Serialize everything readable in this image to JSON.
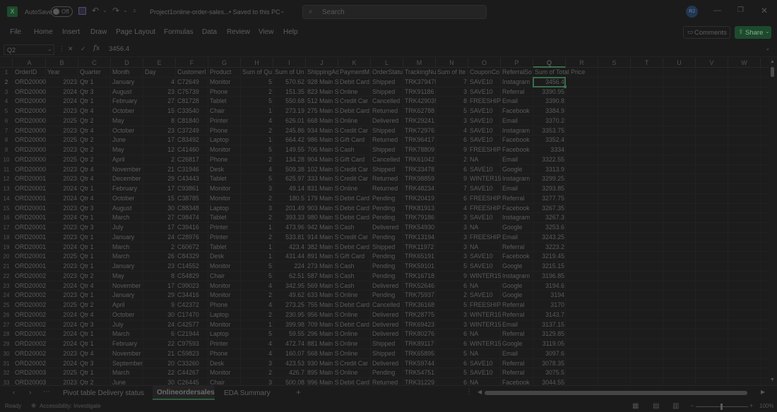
{
  "titlebar": {
    "autosave_label": "AutoSave",
    "autosave_state": "Off",
    "doc_title": "Project1online-order-sales...",
    "saved_status": "• Saved to this PC",
    "search_placeholder": "Search",
    "user_initials": "RJ"
  },
  "ribbon": {
    "tabs": [
      "File",
      "Home",
      "Insert",
      "Draw",
      "Page Layout",
      "Formulas",
      "Data",
      "Review",
      "View",
      "Help"
    ],
    "comments_label": "Comments",
    "share_label": "Share"
  },
  "formula_bar": {
    "name_box": "Q2",
    "fx": "fx",
    "value": "3456.4"
  },
  "columns": [
    "A",
    "B",
    "C",
    "D",
    "E",
    "F",
    "G",
    "H",
    "I",
    "J",
    "K",
    "L",
    "M",
    "N",
    "O",
    "P",
    "Q",
    "R",
    "S",
    "T",
    "U",
    "V",
    "W"
  ],
  "header_row": [
    "OrderID",
    "Year",
    "Quarter",
    "Month",
    "Day",
    "CustomerI",
    "Product",
    "Sum of Qu",
    "Sum of Un",
    "ShippingAd",
    "PaymentM",
    "OrderStatu",
    "TrackingNu",
    "Sum of Ite",
    "CouponCo",
    "ReferralSo",
    "Sum of Total Price"
  ],
  "rows": [
    [
      "ORD20000",
      "2023",
      "Qtr 1",
      "January",
      "4",
      "C72649",
      "Monitor",
      "5",
      "570.62",
      "928 Main S",
      "Debit Card",
      "Shipped",
      "TRK37947!",
      "7",
      "SAVE10",
      "Instagram",
      "3456.4"
    ],
    [
      "ORD20000",
      "2024",
      "Qtr 3",
      "August",
      "23",
      "C75739",
      "Phone",
      "2",
      "151.35",
      "823 Main S",
      "Online",
      "Shipped",
      "TRK91186",
      "3",
      "SAVE10",
      "Referral",
      "3390.95"
    ],
    [
      "ORD20000",
      "2024",
      "Qtr 1",
      "February",
      "27",
      "C81728",
      "Tablet",
      "5",
      "550.68",
      "512 Main S",
      "Credit Car",
      "Cancelled",
      "TRK42903!",
      "8",
      "FREESHIP",
      "Email",
      "3390.8"
    ],
    [
      "ORD20000",
      "2023",
      "Qtr 4",
      "October",
      "15",
      "C33540",
      "Chair",
      "1",
      "273.19",
      "275 Main S",
      "Debit Card",
      "Returned",
      "TRK62788",
      "5",
      "SAVE10",
      "Facebook",
      "3384.9"
    ],
    [
      "ORD20000",
      "2025",
      "Qtr 2",
      "May",
      "8",
      "C81840",
      "Printer",
      "4",
      "626.01",
      "668 Main S",
      "Online",
      "Delivered",
      "TRK29241",
      "3",
      "SAVE10",
      "Email",
      "3370.2"
    ],
    [
      "ORD20000",
      "2023",
      "Qtr 4",
      "October",
      "23",
      "C37249",
      "Phone",
      "2",
      "245.86",
      "934 Main S",
      "Credit Car",
      "Shipped",
      "TRK72976",
      "4",
      "SAVE10",
      "Instagram",
      "3353.75"
    ],
    [
      "ORD20000",
      "2025",
      "Qtr 2",
      "June",
      "17",
      "C83492",
      "Laptop",
      "1",
      "664.42",
      "986 Main S",
      "Gift Card",
      "Returned",
      "TRK96417",
      "6",
      "SAVE10",
      "Facebook",
      "3352.4"
    ],
    [
      "ORD20000",
      "2023",
      "Qtr 2",
      "May",
      "12",
      "C41460",
      "Monitor",
      "5",
      "149.55",
      "706 Main S",
      "Cash",
      "Shipped",
      "TRK78809",
      "9",
      "FREESHIP",
      "Facebook",
      "3334"
    ],
    [
      "ORD20000",
      "2025",
      "Qtr 2",
      "April",
      "2",
      "C26817",
      "Phone",
      "2",
      "134.28",
      "904 Main S",
      "Gift Card",
      "Cancelled",
      "TRK61042",
      "2",
      "NA",
      "Email",
      "3322.55"
    ],
    [
      "ORD20000",
      "2023",
      "Qtr 4",
      "November",
      "21",
      "C31946",
      "Desk",
      "4",
      "509.38",
      "102 Main S",
      "Credit Car",
      "Shipped",
      "TRK33478",
      "6",
      "SAVE10",
      "Google",
      "3313.9"
    ],
    [
      "ORD20001",
      "2023",
      "Qtr 4",
      "December",
      "29",
      "C43443",
      "Tablet",
      "5",
      "625.97",
      "333 Main S",
      "Credit Car",
      "Returned",
      "TRK98859",
      "9",
      "WINTER15",
      "Instagram",
      "3299.25"
    ],
    [
      "ORD20001",
      "2024",
      "Qtr 1",
      "February",
      "17",
      "C93861",
      "Monitor",
      "3",
      "49.14",
      "831 Main S",
      "Online",
      "Returned",
      "TRK48234",
      "7",
      "SAVE10",
      "Email",
      "3293.85"
    ],
    [
      "ORD20001",
      "2024",
      "Qtr 4",
      "October",
      "15",
      "C38785",
      "Monitor",
      "2",
      "180.5",
      "179 Main S",
      "Debit Card",
      "Pending",
      "TRK20419",
      "6",
      "FREESHIP",
      "Referral",
      "3277.75"
    ],
    [
      "ORD20001",
      "2023",
      "Qtr 3",
      "August",
      "30",
      "C88348",
      "Laptop",
      "3",
      "201.49",
      "903 Main S",
      "Debit Card",
      "Pending",
      "TRK81913",
      "4",
      "FREESHIP",
      "Facebook",
      "3267.35"
    ],
    [
      "ORD20001",
      "2024",
      "Qtr 1",
      "March",
      "27",
      "C98474",
      "Tablet",
      "2",
      "393.33",
      "980 Main S",
      "Debit Card",
      "Pending",
      "TRK79186",
      "3",
      "SAVE10",
      "Instagram",
      "3267.3"
    ],
    [
      "ORD20001",
      "2023",
      "Qtr 3",
      "July",
      "17",
      "C39416",
      "Printer",
      "1",
      "473.96",
      "942 Main S",
      "Cash",
      "Delivered",
      "TRK54930",
      "3",
      "NA",
      "Google",
      "3253.6"
    ],
    [
      "ORD20001",
      "2023",
      "Qtr 1",
      "January",
      "24",
      "C28976",
      "Printer",
      "2",
      "533.81",
      "914 Main S",
      "Credit Car",
      "Pending",
      "TRK13194",
      "3",
      "FREESHIP",
      "Email",
      "3243.25"
    ],
    [
      "ORD20001",
      "2024",
      "Qtr 1",
      "March",
      "2",
      "C60672",
      "Tablet",
      "1",
      "423.4",
      "382 Main S",
      "Debit Card",
      "Shipped",
      "TRK11972",
      "3",
      "NA",
      "Referral",
      "3223.2"
    ],
    [
      "ORD20001",
      "2025",
      "Qtr 1",
      "March",
      "26",
      "C84329",
      "Desk",
      "1",
      "431.44",
      "891 Main S",
      "Gift Card",
      "Pending",
      "TRK65191",
      "3",
      "SAVE10",
      "Facebook",
      "3219.45"
    ],
    [
      "ORD20001",
      "2023",
      "Qtr 1",
      "January",
      "23",
      "C14552",
      "Monitor",
      "5",
      "224",
      "273 Main S",
      "Cash",
      "Pending",
      "TRK59101",
      "5",
      "SAVE10",
      "Google",
      "3215.15"
    ],
    [
      "ORD20002",
      "2023",
      "Qtr 2",
      "May",
      "8",
      "C54829",
      "Chair",
      "5",
      "62.51",
      "587 Main S",
      "Cash",
      "Pending",
      "TRK16718",
      "9",
      "WINTER15",
      "Instagram",
      "3196.85"
    ],
    [
      "ORD20002",
      "2024",
      "Qtr 4",
      "November",
      "17",
      "C99023",
      "Monitor",
      "4",
      "342.95",
      "569 Main S",
      "Cash",
      "Delivered",
      "TRK52646",
      "6",
      "NA",
      "Google",
      "3194.6"
    ],
    [
      "ORD20002",
      "2023",
      "Qtr 1",
      "January",
      "29",
      "C34416",
      "Monitor",
      "2",
      "49.62",
      "633 Main S",
      "Online",
      "Pending",
      "TRK75937",
      "2",
      "SAVE10",
      "Google",
      "3194"
    ],
    [
      "ORD20002",
      "2025",
      "Qtr 2",
      "April",
      "9",
      "C42372",
      "Phone",
      "4",
      "273.25",
      "755 Main S",
      "Debit Card",
      "Cancelled",
      "TRK36168",
      "5",
      "FREESHIP",
      "Referral",
      "3170"
    ],
    [
      "ORD20002",
      "2024",
      "Qtr 4",
      "October",
      "30",
      "C17470",
      "Laptop",
      "2",
      "230.95",
      "956 Main S",
      "Online",
      "Delivered",
      "TRK28775",
      "3",
      "WINTER15",
      "Referral",
      "3143.7"
    ],
    [
      "ORD20002",
      "2024",
      "Qtr 3",
      "July",
      "24",
      "C42577",
      "Monitor",
      "1",
      "399.98",
      "709 Main S",
      "Debit Card",
      "Delivered",
      "TRK69423",
      "3",
      "WINTER15",
      "Email",
      "3137.15"
    ],
    [
      "ORD20002",
      "2024",
      "Qtr 1",
      "March",
      "6",
      "C21944",
      "Laptop",
      "5",
      "59.55",
      "296 Main S",
      "Online",
      "Delivered",
      "TRK80276",
      "6",
      "NA",
      "Referral",
      "3129.85"
    ],
    [
      "ORD20002",
      "2024",
      "Qtr 1",
      "February",
      "22",
      "C97593",
      "Printer",
      "4",
      "472.74",
      "881 Main S",
      "Online",
      "Shipped",
      "TRK89117",
      "6",
      "WINTER15",
      "Google",
      "3119.05"
    ],
    [
      "ORD20002",
      "2023",
      "Qtr 4",
      "November",
      "21",
      "C59823",
      "Phone",
      "4",
      "160.07",
      "568 Main S",
      "Online",
      "Shipped",
      "TRK65895",
      "5",
      "NA",
      "Email",
      "3097.6"
    ],
    [
      "ORD20002",
      "2024",
      "Qtr 3",
      "September",
      "20",
      "C33260",
      "Desk",
      "3",
      "423.53",
      "930 Main S",
      "Credit Car",
      "Delivered",
      "TRK59744",
      "6",
      "SAVE10",
      "Referral",
      "3078.35"
    ],
    [
      "ORD20003",
      "2025",
      "Qtr 1",
      "March",
      "22",
      "C44267",
      "Monitor",
      "2",
      "426.7",
      "895 Main S",
      "Online",
      "Pending",
      "TRK54751",
      "5",
      "SAVE10",
      "Referral",
      "3075.5"
    ],
    [
      "ORD20003",
      "2023",
      "Qtr 2",
      "June",
      "30",
      "C26445",
      "Chair",
      "3",
      "500.08",
      "996 Main S",
      "Debit Card",
      "Returned",
      "TRK31229",
      "6",
      "NA",
      "Facebook",
      "3044.55"
    ]
  ],
  "sheet_tabs": [
    "Pivot table Delivery status",
    "Onlineordersales",
    "EDA Summary"
  ],
  "active_sheet": "Onlineordersales",
  "status": {
    "ready": "Ready",
    "accessibility": "Accessibility: Investigate",
    "zoom": "100%"
  },
  "colors": {
    "background": "#1b1b1b",
    "excel_green": "#1d5a35",
    "selection": "#3b6b4c"
  }
}
